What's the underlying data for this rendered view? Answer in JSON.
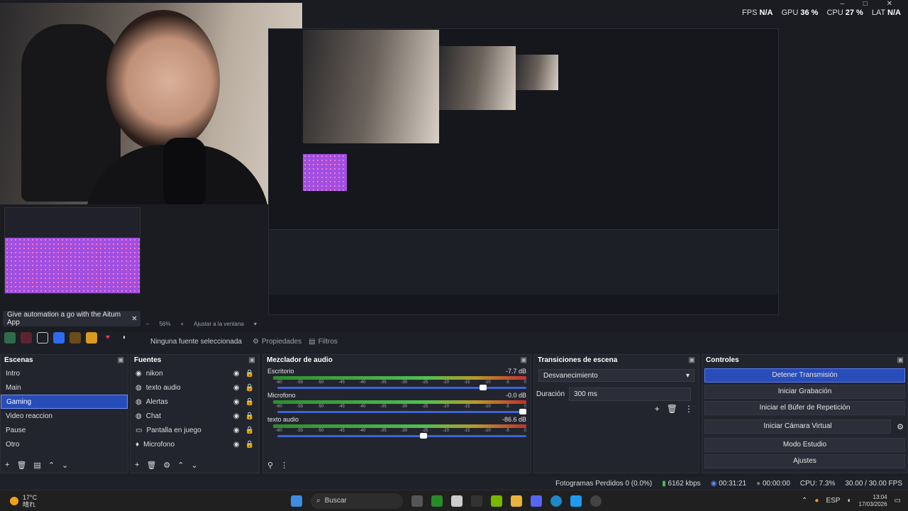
{
  "window": {
    "controls": [
      "–",
      "□",
      "✕"
    ]
  },
  "stats": {
    "fps_label": "FPS",
    "fps_value": "N/A",
    "gpu_label": "GPU",
    "gpu_value": "36 %",
    "cpu_label": "CPU",
    "cpu_value": "27 %",
    "lat_label": "LAT",
    "lat_value": "N/A"
  },
  "notification": {
    "text": "Give automation a go with the Aitum App",
    "close": "✕"
  },
  "zoom": {
    "minus": "–",
    "value": "56%",
    "plus": "+",
    "fit": "Ajustar a la ventana",
    "dropdown": "▾"
  },
  "properties_bar": {
    "no_source": "Ninguna fuente seleccionada",
    "properties": "Propiedades",
    "filters": "Filtros"
  },
  "scenes": {
    "title": "Escenas",
    "items": [
      "Intro",
      "Main",
      "Gaming",
      "Video reaccion",
      "Pause",
      "Otro"
    ],
    "selected": "Gaming"
  },
  "sources": {
    "title": "Fuentes",
    "items": [
      {
        "name": "nikon",
        "icon": "camera-icon"
      },
      {
        "name": "texto audio",
        "icon": "globe-icon"
      },
      {
        "name": "Alertas",
        "icon": "globe-icon"
      },
      {
        "name": "Chat",
        "icon": "globe-icon"
      },
      {
        "name": "Pantalla en juego",
        "icon": "monitor-icon"
      },
      {
        "name": "Microfono",
        "icon": "mic-icon"
      }
    ]
  },
  "mixer": {
    "title": "Mezclador de audio",
    "channels": [
      {
        "name": "Escritorio",
        "db": "-7.7 dB",
        "level": 0.84
      },
      {
        "name": "Microfono",
        "db": "-0.0 dB",
        "level": 1.0
      },
      {
        "name": "texto audio",
        "db": "-86.6 dB",
        "level": 0.6
      }
    ],
    "ticks": [
      "-60",
      "-55",
      "-50",
      "-45",
      "-40",
      "-35",
      "-30",
      "-25",
      "-20",
      "-15",
      "-10",
      "-5",
      "0"
    ]
  },
  "transitions": {
    "title": "Transiciones de escena",
    "selected": "Desvanecimiento",
    "duration_label": "Duración",
    "duration_value": "300 ms"
  },
  "controls": {
    "title": "Controles",
    "buttons": [
      "Detener Transmisión",
      "Iniciar Grabación",
      "Iniciar el Búfer de Repetición",
      "Iniciar Cámara Virtual",
      "Modo Estudio",
      "Ajustes"
    ]
  },
  "status": {
    "dropped": "Fotogramas Perdidos 0 (0.0%)",
    "bitrate": "6162 kbps",
    "stream_time": "00:31:21",
    "rec_time": "00:00:00",
    "cpu": "CPU: 7.3%",
    "fps": "30.00 / 30.00 FPS"
  },
  "taskbar": {
    "weather_temp": "17°C",
    "weather_desc": "晴れ",
    "search": "Buscar",
    "lang": "ESP",
    "time": "13:04",
    "date": "17/03/2026"
  },
  "colors": {
    "accent": "#284cb8",
    "panel": "#23252e",
    "bg": "#1d1f26"
  }
}
